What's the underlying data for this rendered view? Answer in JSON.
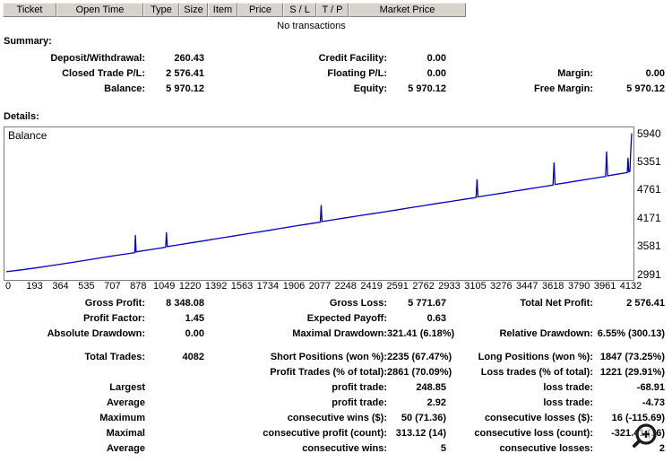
{
  "table": {
    "headers": [
      "Ticket",
      "Open Time",
      "Type",
      "Size",
      "Item",
      "Price",
      "S / L",
      "T / P",
      "Market Price"
    ],
    "empty_text": "No transactions"
  },
  "summary": {
    "heading": "Summary:",
    "rows": [
      [
        "Deposit/Withdrawal:",
        "260.43",
        "Credit Facility:",
        "0.00",
        "",
        ""
      ],
      [
        "Closed Trade P/L:",
        "2 576.41",
        "Floating P/L:",
        "0.00",
        "Margin:",
        "0.00"
      ],
      [
        "Balance:",
        "5 970.12",
        "Equity:",
        "5 970.12",
        "Free Margin:",
        "5 970.12"
      ]
    ]
  },
  "details": {
    "heading": "Details:"
  },
  "chart_data": {
    "type": "line",
    "title": "Balance",
    "legend_position": "top-left-inside",
    "line_color": "#0000c8",
    "grid": false,
    "xlabel": "",
    "ylabel": "",
    "xlim": [
      0,
      4132
    ],
    "ylim": [
      2950,
      5990
    ],
    "x_ticks": [
      0,
      193,
      364,
      535,
      707,
      878,
      1049,
      1220,
      1392,
      1563,
      1734,
      1906,
      2077,
      2248,
      2419,
      2591,
      2762,
      2933,
      3105,
      3276,
      3447,
      3618,
      3790,
      3961,
      4132
    ],
    "y_ticks": [
      5940,
      5351,
      4761,
      4171,
      3581,
      2991
    ],
    "points": [
      [
        0,
        3045
      ],
      [
        100,
        3085
      ],
      [
        193,
        3125
      ],
      [
        280,
        3165
      ],
      [
        364,
        3205
      ],
      [
        450,
        3248
      ],
      [
        535,
        3290
      ],
      [
        620,
        3335
      ],
      [
        707,
        3378
      ],
      [
        780,
        3412
      ],
      [
        840,
        3440
      ],
      [
        849,
        3445
      ],
      [
        853,
        3815
      ],
      [
        858,
        3460
      ],
      [
        878,
        3472
      ],
      [
        940,
        3502
      ],
      [
        1000,
        3532
      ],
      [
        1045,
        3555
      ],
      [
        1053,
        3558
      ],
      [
        1058,
        3870
      ],
      [
        1064,
        3572
      ],
      [
        1130,
        3605
      ],
      [
        1220,
        3650
      ],
      [
        1310,
        3695
      ],
      [
        1392,
        3738
      ],
      [
        1480,
        3782
      ],
      [
        1563,
        3825
      ],
      [
        1650,
        3868
      ],
      [
        1734,
        3910
      ],
      [
        1820,
        3955
      ],
      [
        1906,
        4000
      ],
      [
        1990,
        4042
      ],
      [
        2068,
        4080
      ],
      [
        2075,
        4082
      ],
      [
        2080,
        4440
      ],
      [
        2086,
        4095
      ],
      [
        2160,
        4132
      ],
      [
        2248,
        4175
      ],
      [
        2335,
        4218
      ],
      [
        2419,
        4260
      ],
      [
        2505,
        4302
      ],
      [
        2591,
        4345
      ],
      [
        2675,
        4388
      ],
      [
        2762,
        4430
      ],
      [
        2850,
        4475
      ],
      [
        2933,
        4515
      ],
      [
        3020,
        4558
      ],
      [
        3098,
        4595
      ],
      [
        3104,
        4598
      ],
      [
        3110,
        4980
      ],
      [
        3116,
        4610
      ],
      [
        3195,
        4650
      ],
      [
        3276,
        4690
      ],
      [
        3360,
        4732
      ],
      [
        3447,
        4775
      ],
      [
        3530,
        4818
      ],
      [
        3612,
        4858
      ],
      [
        3619,
        5330
      ],
      [
        3626,
        4872
      ],
      [
        3700,
        4908
      ],
      [
        3790,
        4955
      ],
      [
        3870,
        4995
      ],
      [
        3952,
        5035
      ],
      [
        3960,
        5038
      ],
      [
        3966,
        5560
      ],
      [
        3973,
        5052
      ],
      [
        4015,
        5075
      ],
      [
        4055,
        5095
      ],
      [
        4085,
        5110
      ],
      [
        4103,
        5122
      ],
      [
        4108,
        5430
      ],
      [
        4113,
        5135
      ],
      [
        4120,
        5145
      ],
      [
        4126,
        5600
      ],
      [
        4132,
        5940
      ]
    ]
  },
  "stats": {
    "rows": [
      [
        "Gross Profit:",
        "8 348.08",
        "Gross Loss:",
        "5 771.67",
        "Total Net Profit:",
        "2 576.41"
      ],
      [
        "Profit Factor:",
        "1.45",
        "Expected Payoff:",
        "0.63",
        "",
        ""
      ],
      [
        "Absolute Drawdown:",
        "0.00",
        "Maximal Drawdown:",
        "321.41 (6.18%)",
        "Relative Drawdown:",
        "6.55% (300.13)"
      ],
      [
        "Total Trades:",
        "4082",
        "Short Positions (won %):",
        "2235 (67.47%)",
        "Long Positions (won %):",
        "1847 (73.25%)"
      ],
      [
        "",
        "",
        "Profit Trades (% of total):",
        "2861 (70.09%)",
        "Loss trades (% of total):",
        "1221 (29.91%)"
      ],
      [
        "Largest",
        "",
        "profit trade:",
        "248.85",
        "loss trade:",
        "-68.91"
      ],
      [
        "Average",
        "",
        "profit trade:",
        "2.92",
        "loss trade:",
        "-4.73"
      ],
      [
        "Maximum",
        "",
        "consecutive wins ($):",
        "50 (71.36)",
        "consecutive losses ($):",
        "16 (-115.69)"
      ],
      [
        "Maximal",
        "",
        "consecutive profit (count):",
        "313.12 (14)",
        "consecutive loss (count):",
        "-321.41 (16)"
      ],
      [
        "Average",
        "",
        "consecutive wins:",
        "5",
        "consecutive losses:",
        "2"
      ]
    ]
  }
}
